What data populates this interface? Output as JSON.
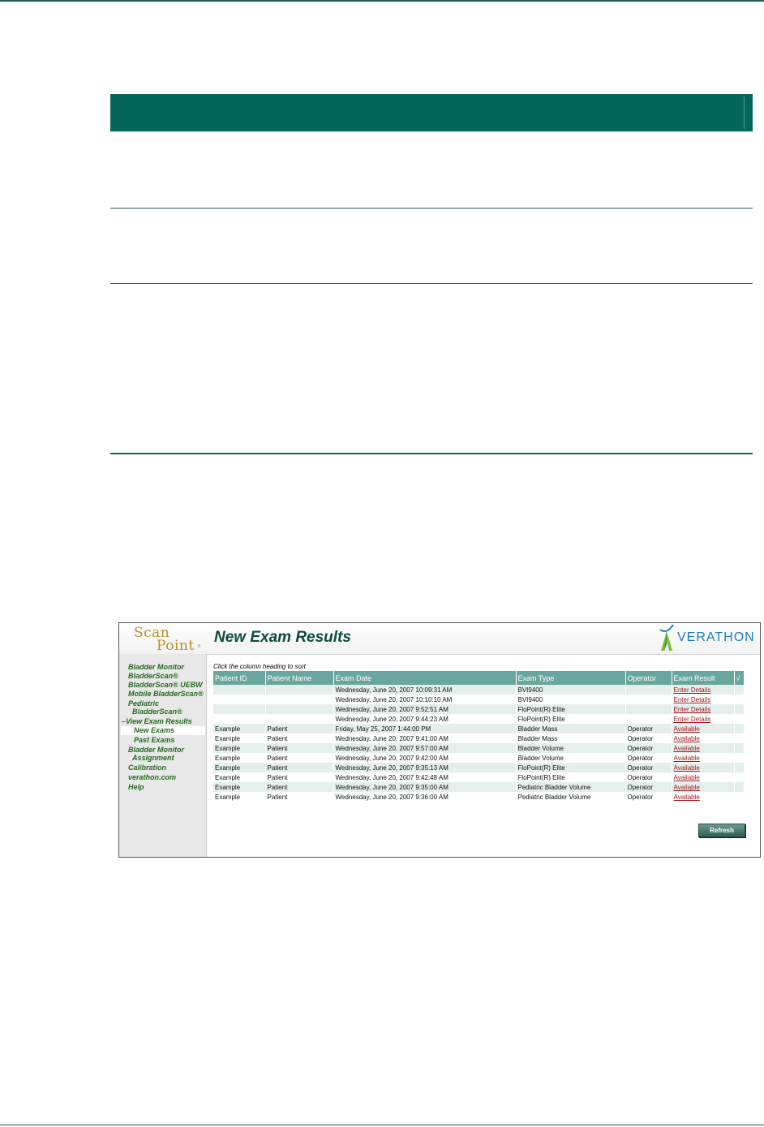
{
  "app": {
    "logo_line1": "Scan",
    "logo_line2": "Point",
    "logo_reg": "®",
    "page_title": "New Exam Results",
    "brand": "VERATHON"
  },
  "sidebar": {
    "items": [
      {
        "label": "Bladder Monitor"
      },
      {
        "label": "BladderScan®"
      },
      {
        "label": "BladderScan® UEBW"
      },
      {
        "label": "Mobile BladderScan®"
      },
      {
        "label": "Pediatric"
      },
      {
        "label": "BladderScan®"
      },
      {
        "label": "–View Exam Results"
      },
      {
        "label": "New Exams"
      },
      {
        "label": "Past Exams"
      },
      {
        "label": "Bladder Monitor"
      },
      {
        "label": "Assignment"
      },
      {
        "label": "Calibration"
      },
      {
        "label": "verathon.com"
      },
      {
        "label": "Help"
      }
    ]
  },
  "main": {
    "sort_hint": "Click the column heading to sort",
    "columns": [
      "Patient ID",
      "Patient Name",
      "Exam Date",
      "Exam Type",
      "Operator",
      "Exam Result",
      "√"
    ],
    "rows": [
      {
        "id": "",
        "name": "",
        "date": "Wednesday, June 20, 2007 10:09:31 AM",
        "type": "BVI9400",
        "operator": "",
        "result": "Enter Details"
      },
      {
        "id": "",
        "name": "",
        "date": "Wednesday, June 20, 2007 10:10:10 AM",
        "type": "BVI9400",
        "operator": "",
        "result": "Enter Details"
      },
      {
        "id": "",
        "name": "",
        "date": "Wednesday, June 20, 2007 9:52:51 AM",
        "type": "FloPoint(R) Elite",
        "operator": "",
        "result": "Enter Details"
      },
      {
        "id": "",
        "name": "",
        "date": "Wednesday, June 20, 2007 9:44:23 AM",
        "type": "FloPoint(R) Elite",
        "operator": "",
        "result": "Enter Details"
      },
      {
        "id": "Example",
        "name": "Patient",
        "date": "Friday, May 25, 2007 1:44:00 PM",
        "type": "Bladder Mass",
        "operator": "Operator",
        "result": "Available"
      },
      {
        "id": "Example",
        "name": "Patient",
        "date": "Wednesday, June 20, 2007 9:41:00 AM",
        "type": "Bladder Mass",
        "operator": "Operator",
        "result": "Available"
      },
      {
        "id": "Example",
        "name": "Patient",
        "date": "Wednesday, June 20, 2007 9:57:00 AM",
        "type": "Bladder Volume",
        "operator": "Operator",
        "result": "Available"
      },
      {
        "id": "Example",
        "name": "Patient",
        "date": "Wednesday, June 20, 2007 9:42:00 AM",
        "type": "Bladder Volume",
        "operator": "Operator",
        "result": "Available"
      },
      {
        "id": "Example",
        "name": "Patient",
        "date": "Wednesday, June 20, 2007 9:35:13 AM",
        "type": "FloPoint(R) Elite",
        "operator": "Operator",
        "result": "Available"
      },
      {
        "id": "Example",
        "name": "Patient",
        "date": "Wednesday, June 20, 2007 9:42:48 AM",
        "type": "FloPoint(R) Elite",
        "operator": "Operator",
        "result": "Available"
      },
      {
        "id": "Example",
        "name": "Patient",
        "date": "Wednesday, June 20, 2007 9:35:00 AM",
        "type": "Pediatric Bladder Volume",
        "operator": "Operator",
        "result": "Available"
      },
      {
        "id": "Example",
        "name": "Patient",
        "date": "Wednesday, June 20, 2007 9:36:00 AM",
        "type": "Pediatric Bladder Volume",
        "operator": "Operator",
        "result": "Available"
      }
    ],
    "refresh_label": "Refresh"
  },
  "colors": {
    "page_teal": "#04665b",
    "header_row": "#6aa69e",
    "nav_green": "#236a1f",
    "link_red": "#a3171d",
    "brand_blue": "#1f7bbf",
    "logo_gold": "#b8902e"
  }
}
